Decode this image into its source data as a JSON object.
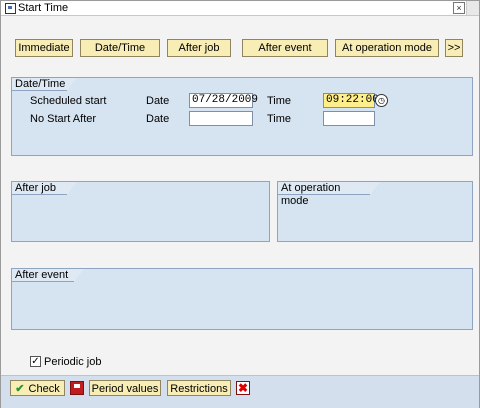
{
  "window": {
    "title": "Start Time",
    "close_glyph": "×"
  },
  "toolbar": {
    "immediate_label": "Immediate",
    "datetime_label": "Date/Time",
    "after_job_label": "After job",
    "after_event_label": "After event",
    "at_operation_mode_label": "At operation mode",
    "more_label": ">>"
  },
  "datetime_panel": {
    "title": "Date/Time",
    "scheduled_start_label": "Scheduled start",
    "no_start_after_label": "No Start After",
    "date_label": "Date",
    "time_label": "Time",
    "scheduled_date_value": "07/28/2009",
    "scheduled_time_value": "09:22:00",
    "no_start_date_value": "",
    "no_start_time_value": ""
  },
  "after_job_panel": {
    "title": "After job"
  },
  "at_operation_mode_panel": {
    "title": "At operation mode"
  },
  "after_event_panel": {
    "title": "After event"
  },
  "periodic_job": {
    "label": "Periodic job",
    "checked": true,
    "check_glyph": "✓"
  },
  "bottom": {
    "check_label": "Check",
    "period_values_label": "Period values",
    "restrictions_label": "Restrictions"
  }
}
